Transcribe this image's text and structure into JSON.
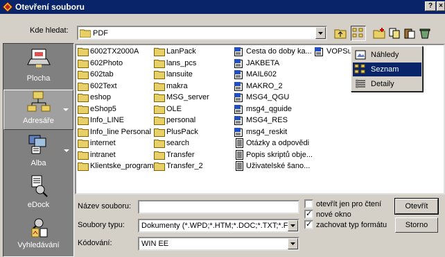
{
  "window": {
    "title": "Otevření souboru",
    "help_label": "?",
    "close_label": "×"
  },
  "lookin": {
    "label": "Kde hledat:",
    "value": "PDF"
  },
  "places": [
    {
      "label": "Plocha",
      "icon": "desktop-icon"
    },
    {
      "label": "Adresáře",
      "icon": "folders-icon"
    },
    {
      "label": "Alba",
      "icon": "albums-icon"
    },
    {
      "label": "eDock",
      "icon": "edock-icon"
    },
    {
      "label": "Vyhledávání",
      "icon": "search-icon"
    }
  ],
  "files": {
    "col1": [
      "6002TX2000A",
      "602Photo",
      "602tab",
      "602Text",
      "eshop",
      "eShop5",
      "Info_LINE",
      "Info_line Personal",
      "internet",
      "intranet",
      "Klientske_programy"
    ],
    "col2": [
      "LanPack",
      "lans_pcs",
      "lansuite",
      "makra",
      "MSG_server",
      "OLE",
      "personal",
      "PlusPack",
      "search",
      "Transfer",
      "Transfer_2"
    ],
    "col3": [
      "Cesta do doby ka...",
      "JAKBETA",
      "MAIL602",
      "MAKRO_2",
      "MSG4_QGU",
      "msg4_qguide",
      "MSG4_RES",
      "msg4_reskit",
      "Otázky a odpovědi",
      "Popis skriptů obje...",
      "Uživatelské šano..."
    ],
    "col4": [
      "VOPSu"
    ]
  },
  "view_menu": {
    "items": [
      "Náhledy",
      "Seznam",
      "Detaily"
    ],
    "selected": "Seznam"
  },
  "form": {
    "filename_label": "Název souboru:",
    "filename_value": "",
    "filetype_label": "Soubory typu:",
    "filetype_value": "Dokumenty (*.WPD;*.HTM;*.DOC;*.TXT;*.F",
    "encoding_label": "Kódování:",
    "encoding_value": "WIN EE"
  },
  "options": [
    {
      "label": "otevřít jen pro čtení",
      "checked": false
    },
    {
      "label": "nové okno",
      "checked": true
    },
    {
      "label": "zachovat typ formátu",
      "checked": true
    }
  ],
  "buttons": {
    "open": "Otevřít",
    "cancel": "Storno"
  },
  "colors": {
    "titlebar": "#0a246a",
    "face": "#d4d0c8",
    "folder": "#e8d068",
    "places_bg": "#808080"
  }
}
